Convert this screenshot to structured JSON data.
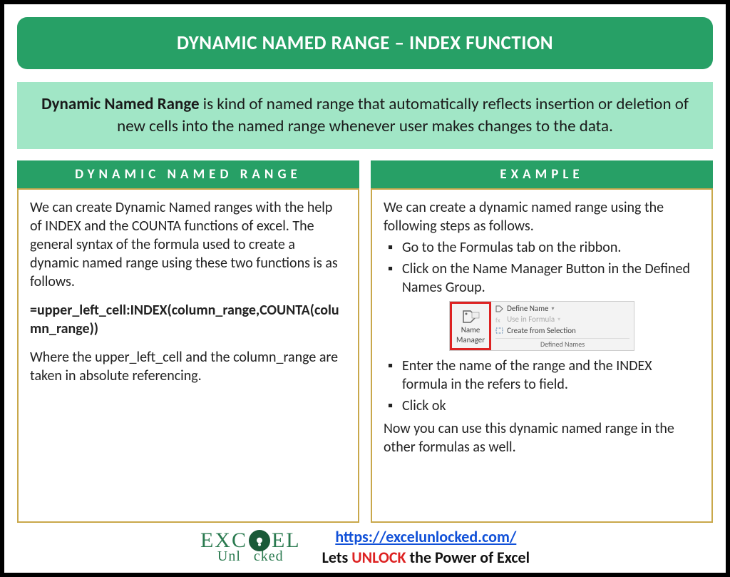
{
  "title": "DYNAMIC NAMED RANGE – INDEX FUNCTION",
  "definition": {
    "bold": "Dynamic Named Range",
    "rest": " is kind of named range that automatically reflects insertion or deletion of new cells into the named range whenever user makes changes to the data."
  },
  "left": {
    "header": "DYNAMIC NAMED RANGE",
    "p1": "We can create Dynamic Named ranges with the help of INDEX and the COUNTA functions of excel. The general syntax of the formula used to create a dynamic named range using these two functions is as follows.",
    "formula": "=upper_left_cell:INDEX(column_range,COUNTA(column_range))",
    "p2": "Where the upper_left_cell and the column_range are taken in absolute referencing."
  },
  "right": {
    "header": "EXAMPLE",
    "intro": "We can create a dynamic named range using the following steps as follows.",
    "steps_a": [
      "Go to the Formulas tab on the ribbon.",
      "Click on the Name Manager Button in the Defined Names Group."
    ],
    "ribbon": {
      "button_line1": "Name",
      "button_line2": "Manager",
      "opt1": "Define Name",
      "opt2": "Use in Formula",
      "opt3": "Create from Selection",
      "group": "Defined Names"
    },
    "steps_b": [
      "Enter the name of the range and the INDEX formula in the refers to field.",
      "Click ok"
    ],
    "outro": "Now you can use this dynamic named range in the other formulas as well."
  },
  "footer": {
    "brand_top": "EXC  EL",
    "brand_sub": "Unl   cked",
    "url": "https://excelunlocked.com/",
    "tagline_pre": "Lets ",
    "tagline_unlock": "UNLOCK",
    "tagline_post": " the Power of Excel"
  }
}
